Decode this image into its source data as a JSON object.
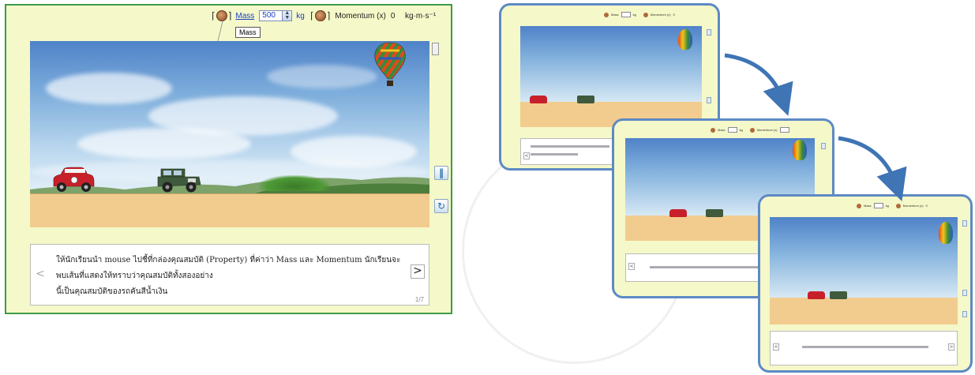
{
  "simulation": {
    "mass_label": "Mass",
    "mass_value": "500",
    "mass_unit": "kg",
    "momentum_label": "Momentum (x)",
    "momentum_value": "0",
    "momentum_unit": "kg·m·s⁻¹",
    "tooltip": "Mass",
    "instruction_line1": "ให้นักเรียนนำ mouse ไปชี้ที่กล่องคุณสมบัติ (Property) ที่ค่าว่า Mass และ Momentum นักเรียนจะพบเส้นที่แสดงให้ทราบว่าคุณสมบัติทั้งสองอย่าง",
    "instruction_line2": "นี้เป็นคุณสมบัติของรถคันสีน้ำเงิน",
    "page": "1/7",
    "prev_icon": "chevron-left-icon",
    "next_icon": "chevron-right-icon",
    "pause_icon": "pause-icon",
    "reset_icon": "refresh-icon"
  },
  "colors": {
    "window_border": "#3d9b46",
    "panel_bg": "#f5f8c8",
    "thumb_border": "#5d8ac4",
    "arrow": "#3f74b5",
    "ground": "#f2cc8e",
    "red_car": "#c8202a",
    "green_jeep": "#3f5a3c"
  }
}
